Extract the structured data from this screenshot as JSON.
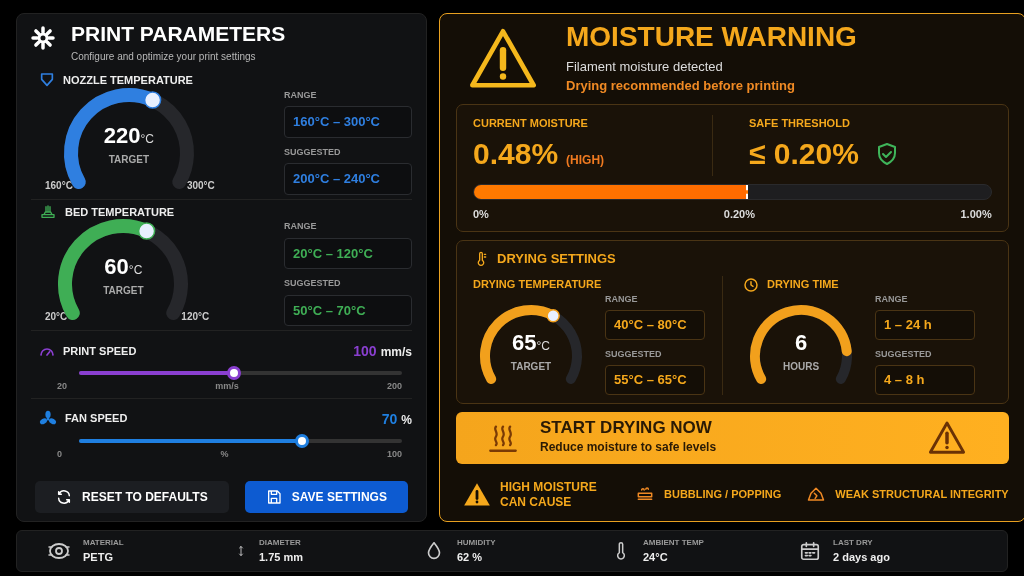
{
  "panel": {
    "title": "PRINT PARAMETERS",
    "subtitle": "Configure and optimize your print settings"
  },
  "temperatures": [
    {
      "kind": "nozzle",
      "label": "NOZZLE TEMPERATURE",
      "color": "#2f7fe0",
      "value": "220",
      "unit": "°C",
      "caption": "TARGET",
      "min": "160°C",
      "max": "300°C",
      "range_label": "RANGE",
      "range": "160°C – 300°C",
      "suggested_label": "SUGGESTED",
      "suggested": "200°C – 240°C"
    },
    {
      "kind": "bed",
      "label": "BED TEMPERATURE",
      "color": "#3fae55",
      "value": "60",
      "unit": "°C",
      "caption": "TARGET",
      "min": "20°C",
      "max": "120°C",
      "range_label": "RANGE",
      "range": "20°C – 120°C",
      "suggested_label": "SUGGESTED",
      "suggested": "50°C – 70°C"
    }
  ],
  "sliders": [
    {
      "kind": "speed",
      "label": "PRINT SPEED",
      "color": "#8a3fd0",
      "value": "100",
      "unit": "mm/s",
      "level": 0.48,
      "min": "20",
      "mid": "mm/s",
      "max": "200"
    },
    {
      "kind": "fan",
      "label": "FAN SPEED",
      "color": "#1f7fe0",
      "value": "70",
      "unit": "%",
      "level": 0.69,
      "min": "0",
      "mid": "%",
      "max": "100"
    }
  ],
  "buttons": [
    {
      "kind": "reset",
      "label": "RESET TO DEFAULTS"
    },
    {
      "kind": "save",
      "label": "SAVE SETTINGS"
    }
  ],
  "warning": {
    "title": "MOISTURE WARNING",
    "message": "Filament moisture detected",
    "recommendation": "Drying recommended before printing"
  },
  "moisture": {
    "current_label": "CURRENT MOISTURE",
    "current": "0.48%",
    "note": "(HIGH)",
    "threshold_label": "SAFE THRESHOLD",
    "threshold": "≤ 0.20%",
    "level": 0.53,
    "ticks": [
      "0%",
      "0.20%",
      "1.00%"
    ]
  },
  "drying": {
    "title": "DRYING SETTINGS",
    "blocks": [
      {
        "kind": "temperature",
        "label": "DRYING TEMPERATURE",
        "value": "65",
        "unit": "°C",
        "caption": "TARGET",
        "range_label": "RANGE",
        "range": "40°C – 80°C",
        "suggested_label": "SUGGESTED",
        "suggested": "55°C – 65°C"
      },
      {
        "kind": "time",
        "label": "DRYING TIME",
        "value": "6",
        "caption": "HOURS",
        "range_label": "RANGE",
        "range": "1 – 24 h",
        "suggested_label": "SUGGESTED",
        "suggested": "4 – 8 h"
      }
    ]
  },
  "action": {
    "title": "START DRYING NOW",
    "subtitle": "Reduce moisture to safe levels"
  },
  "effects": {
    "heading": "HIGH MOISTURE CAN CAUSE",
    "items": [
      {
        "kind": "bubbling",
        "label": "BUBBLING / POPPING"
      },
      {
        "kind": "weak",
        "label": "WEAK STRUCTURAL INTEGRITY"
      }
    ]
  },
  "status_bar": [
    {
      "kind": "material",
      "label": "MATERIAL",
      "value": "PETG"
    },
    {
      "kind": "diameter",
      "label": "DIAMETER",
      "value": "1.75 mm"
    },
    {
      "kind": "humidity",
      "label": "HUMIDITY",
      "value": "62 %"
    },
    {
      "kind": "ambient",
      "label": "AMBIENT TEMP",
      "value": "24°C"
    },
    {
      "kind": "calendar",
      "label": "LAST DRY",
      "value": "2 days ago"
    }
  ]
}
